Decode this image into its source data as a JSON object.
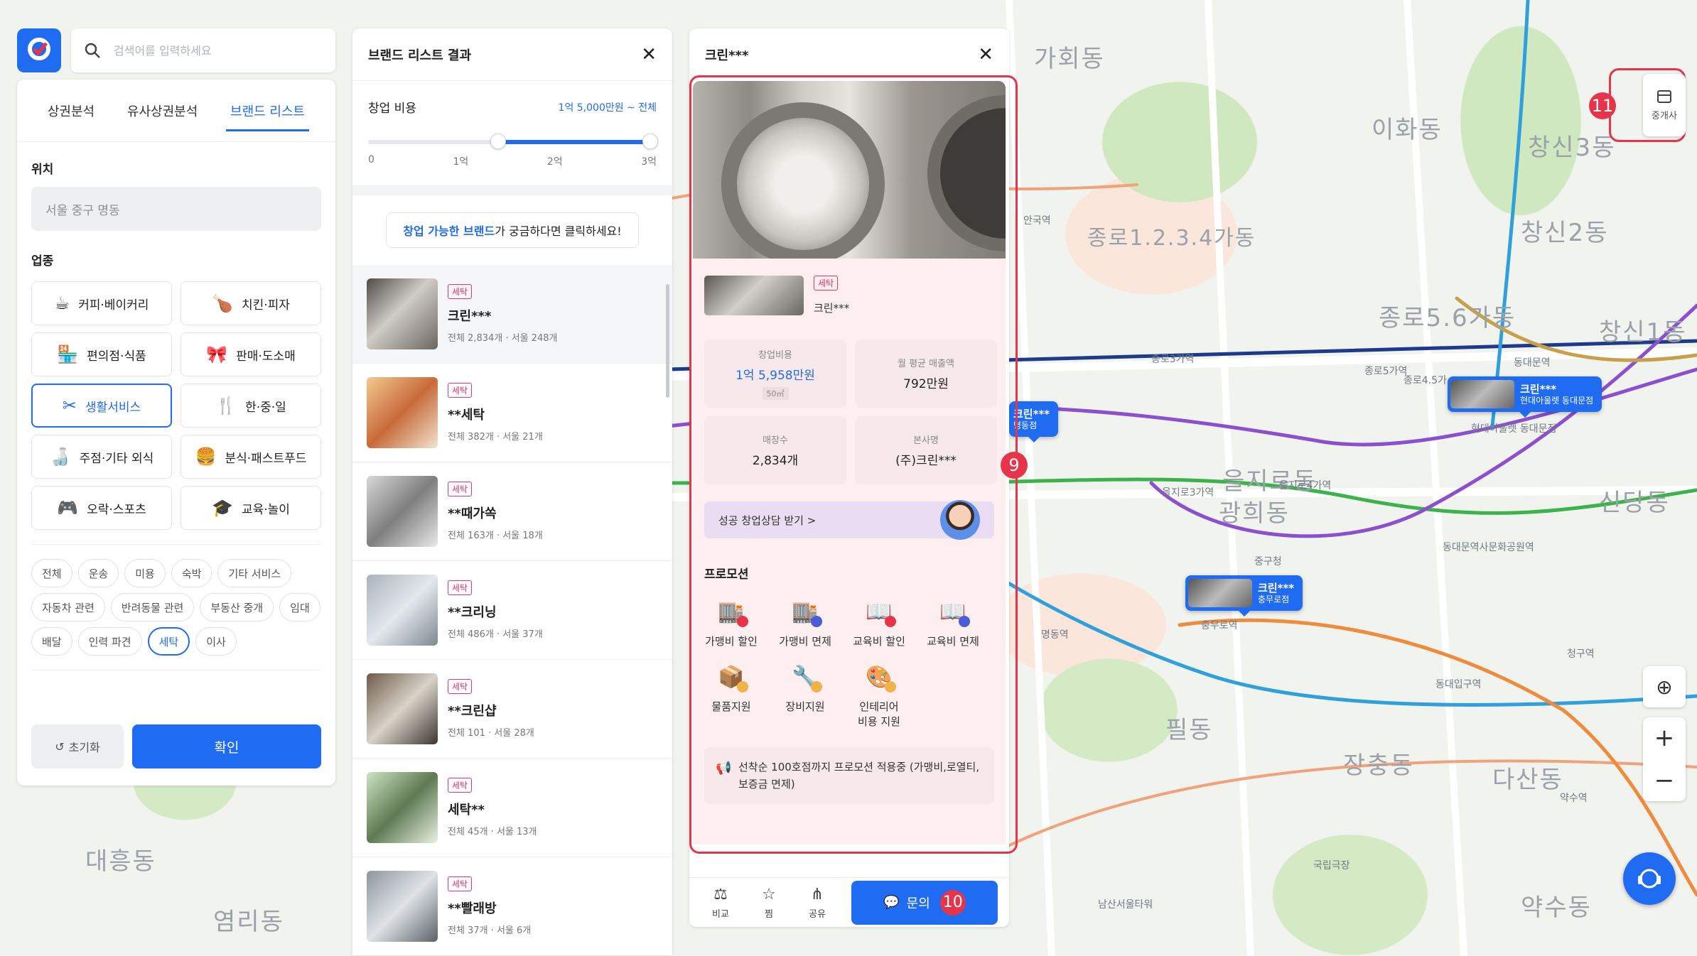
{
  "search": {
    "placeholder": "검색어를 입력하세요"
  },
  "tabs": [
    "상권분석",
    "유사상권분석",
    "브랜드 리스트"
  ],
  "location": {
    "label": "위치",
    "value": "서울 중구 명동"
  },
  "category": {
    "label": "업종",
    "items": [
      {
        "label": "커피·베이커리",
        "icon": "coffee-icon"
      },
      {
        "label": "치킨·피자",
        "icon": "chicken-icon"
      },
      {
        "label": "편의점·식품",
        "icon": "store-icon"
      },
      {
        "label": "판매·도소매",
        "icon": "gift-icon"
      },
      {
        "label": "생활서비스",
        "icon": "scissors-icon",
        "selected": true
      },
      {
        "label": "한·중·일",
        "icon": "utensils-icon"
      },
      {
        "label": "주점·기타 외식",
        "icon": "bottle-icon"
      },
      {
        "label": "분식·패스트푸드",
        "icon": "snack-icon"
      },
      {
        "label": "오락·스포츠",
        "icon": "game-icon"
      },
      {
        "label": "교육·놀이",
        "icon": "graduation-icon"
      }
    ]
  },
  "subcategories": [
    {
      "label": "전체"
    },
    {
      "label": "운송"
    },
    {
      "label": "미용"
    },
    {
      "label": "숙박"
    },
    {
      "label": "기타 서비스"
    },
    {
      "label": "자동차 관련"
    },
    {
      "label": "반려동물 관련"
    },
    {
      "label": "부동산 중개"
    },
    {
      "label": "임대"
    },
    {
      "label": "배달"
    },
    {
      "label": "인력 파견"
    },
    {
      "label": "세탁",
      "selected": true
    },
    {
      "label": "이사"
    }
  ],
  "buttons": {
    "reset": "초기화",
    "confirm": "확인"
  },
  "result_panel": {
    "title": "브랜드 리스트 결과",
    "cost_label": "창업 비용",
    "cost_range": "1억 5,000만원 ~ 전체",
    "slider_value_fraction": 0.45,
    "ticks": [
      "0",
      "1억",
      "2억",
      "3억"
    ],
    "promo_highlight": "창업 가능한 브랜드",
    "promo_rest": "가 궁금하다면 클릭하세요!",
    "items": [
      {
        "tag": "세탁",
        "name": "크린***",
        "sub": "전체 2,834개 · 서울 248개"
      },
      {
        "tag": "세탁",
        "name": "**세탁",
        "sub": "전체 382개 · 서울 21개"
      },
      {
        "tag": "세탁",
        "name": "**때가쏙",
        "sub": "전체 163개 · 서울 18개"
      },
      {
        "tag": "세탁",
        "name": "**크리닝",
        "sub": "전체 486개 · 서울 37개"
      },
      {
        "tag": "세탁",
        "name": "**크린샵",
        "sub": "전체 101 · 서울 28개"
      },
      {
        "tag": "세탁",
        "name": "세탁**",
        "sub": "전체 45개 · 서울 13개"
      },
      {
        "tag": "세탁",
        "name": "**빨래방",
        "sub": "전체 37개 · 서울 6개"
      }
    ]
  },
  "detail": {
    "title": "크린***",
    "tag": "세탁",
    "brand_name": "크린***",
    "stats": [
      {
        "label": "창업비용",
        "value": "1억 5,958만원",
        "unit": "50㎡"
      },
      {
        "label": "월 평균 매출액",
        "value": "792만원"
      },
      {
        "label": "매장수",
        "value": "2,834개"
      },
      {
        "label": "본사명",
        "value": "(주)크린***"
      }
    ],
    "consult": "성공 창업상담 받기 >",
    "promotion_title": "프로모션",
    "benefits": [
      {
        "label": "가맹비 할인",
        "icon": "franchise-discount-icon"
      },
      {
        "label": "가맹비 면제",
        "icon": "franchise-waive-icon"
      },
      {
        "label": "교육비 할인",
        "icon": "education-discount-icon"
      },
      {
        "label": "교육비 면제",
        "icon": "education-waive-icon"
      },
      {
        "label": "물품지원",
        "icon": "goods-support-icon"
      },
      {
        "label": "장비지원",
        "icon": "equipment-support-icon"
      },
      {
        "label": "인테리어\n비용 지원",
        "icon": "interior-support-icon"
      }
    ],
    "note": "선착순 100호점까지 프로모션 적용중 (가맹비,로열티, 보증금 면제)",
    "footer": {
      "compare": "비교",
      "favorite": "찜",
      "share": "공유",
      "inquiry": "문의"
    }
  },
  "badges": [
    "9",
    "10",
    "11"
  ],
  "map": {
    "broker_button": "중개사",
    "markers": [
      {
        "name": "크린***",
        "branch": "명동점"
      },
      {
        "name": "크린***",
        "branch": "현대아울렛 동대문점"
      },
      {
        "name": "크린***",
        "branch": "충무로점"
      }
    ],
    "areas": [
      "가회동",
      "종로1.2.3.4가동",
      "종로5.6가동",
      "창신2동",
      "창신1동",
      "창신3동",
      "을지로동",
      "광희동",
      "신당동",
      "필동",
      "장충동",
      "다산동",
      "약수동",
      "대흥동",
      "염리동",
      "이화동"
    ],
    "places": [
      "안국역",
      "종로3가역",
      "종로5가역",
      "동대문역",
      "을지로3가역",
      "을지로4가역",
      "명동역",
      "충무로역",
      "동대입구역",
      "동대문역사문화공원역",
      "청구역",
      "약수역",
      "종로4.5가",
      "중구청",
      "국립극장",
      "남산서울타워",
      "현대아울렛 동대문점"
    ]
  },
  "colors": {
    "accent": "#1f6bf2",
    "tag": "#e8346d",
    "highlight": "#e8344a"
  }
}
